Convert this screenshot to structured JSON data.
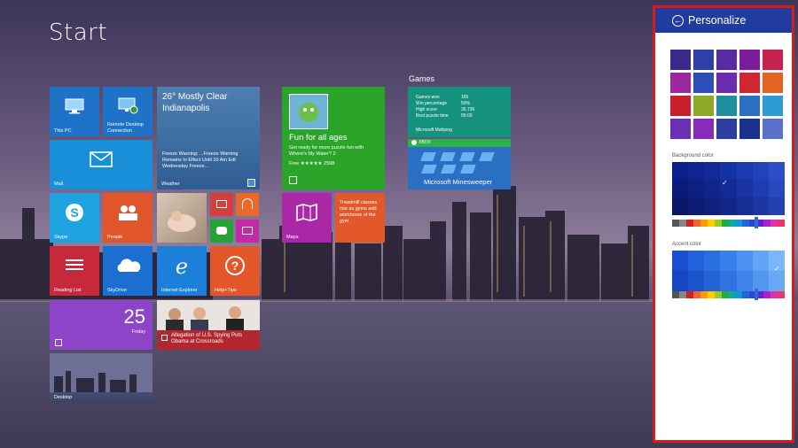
{
  "screen": {
    "title": "Start"
  },
  "groups": {
    "games": "Games"
  },
  "tiles": {
    "this_pc": "This PC",
    "remote_desktop": "Remote Desktop Connection",
    "weather_temp": "26° Mostly Clear",
    "weather_city": "Indianapolis",
    "weather_detail": "Freeze Warning: ...Freeze Warning Remains In Effect Until 10 Am Edt Wednesday Freeze...",
    "weather_label": "Weather",
    "mail": "Mail",
    "store_headline": "Fun for all ages",
    "store_sub": "Get ready for more puzzle fun with Where's My Water? 2",
    "store_price": "Free ★★★★★ 2598",
    "games_stats": [
      {
        "k": "Games won",
        "v": "165"
      },
      {
        "k": "Win percentage",
        "v": "50%"
      },
      {
        "k": "High score",
        "v": "35,736"
      },
      {
        "k": "Best puzzle time",
        "v": "05:00"
      }
    ],
    "mahjong": "Microsoft Mahjong",
    "xbox": "XBOX",
    "minesweeper": "Microsoft Minesweeper",
    "skype": "Skype",
    "people": "People",
    "maps": "Maps",
    "news_small": "Treadmill classes rise as gyms add workhorse of the gym",
    "reading_list": "Reading List",
    "skydrive": "SkyDrive",
    "ie": "Internet Explorer",
    "help": "Help+Tips",
    "calendar_day": "25",
    "calendar_weekday": "Friday",
    "news_headline": "Allegation of U.S. Spying Puts Obama at Crossroads",
    "desktop": "Desktop"
  },
  "panel": {
    "title": "Personalize",
    "background_color_label": "Background color",
    "accent_color_label": "Accent color",
    "accent_panel_color": "#1f3c9e",
    "frame_color": "#d81b1b"
  },
  "icons": [
    "back-arrow-icon",
    "computer-icon",
    "remote-desktop-icon",
    "mail-icon",
    "skype-icon",
    "people-icon",
    "maps-icon",
    "reading-list-icon",
    "cloud-icon",
    "ie-icon",
    "help-icon",
    "store-bag-icon",
    "xbox-icon",
    "calendar-icon",
    "news-icon",
    "weather-icon"
  ]
}
